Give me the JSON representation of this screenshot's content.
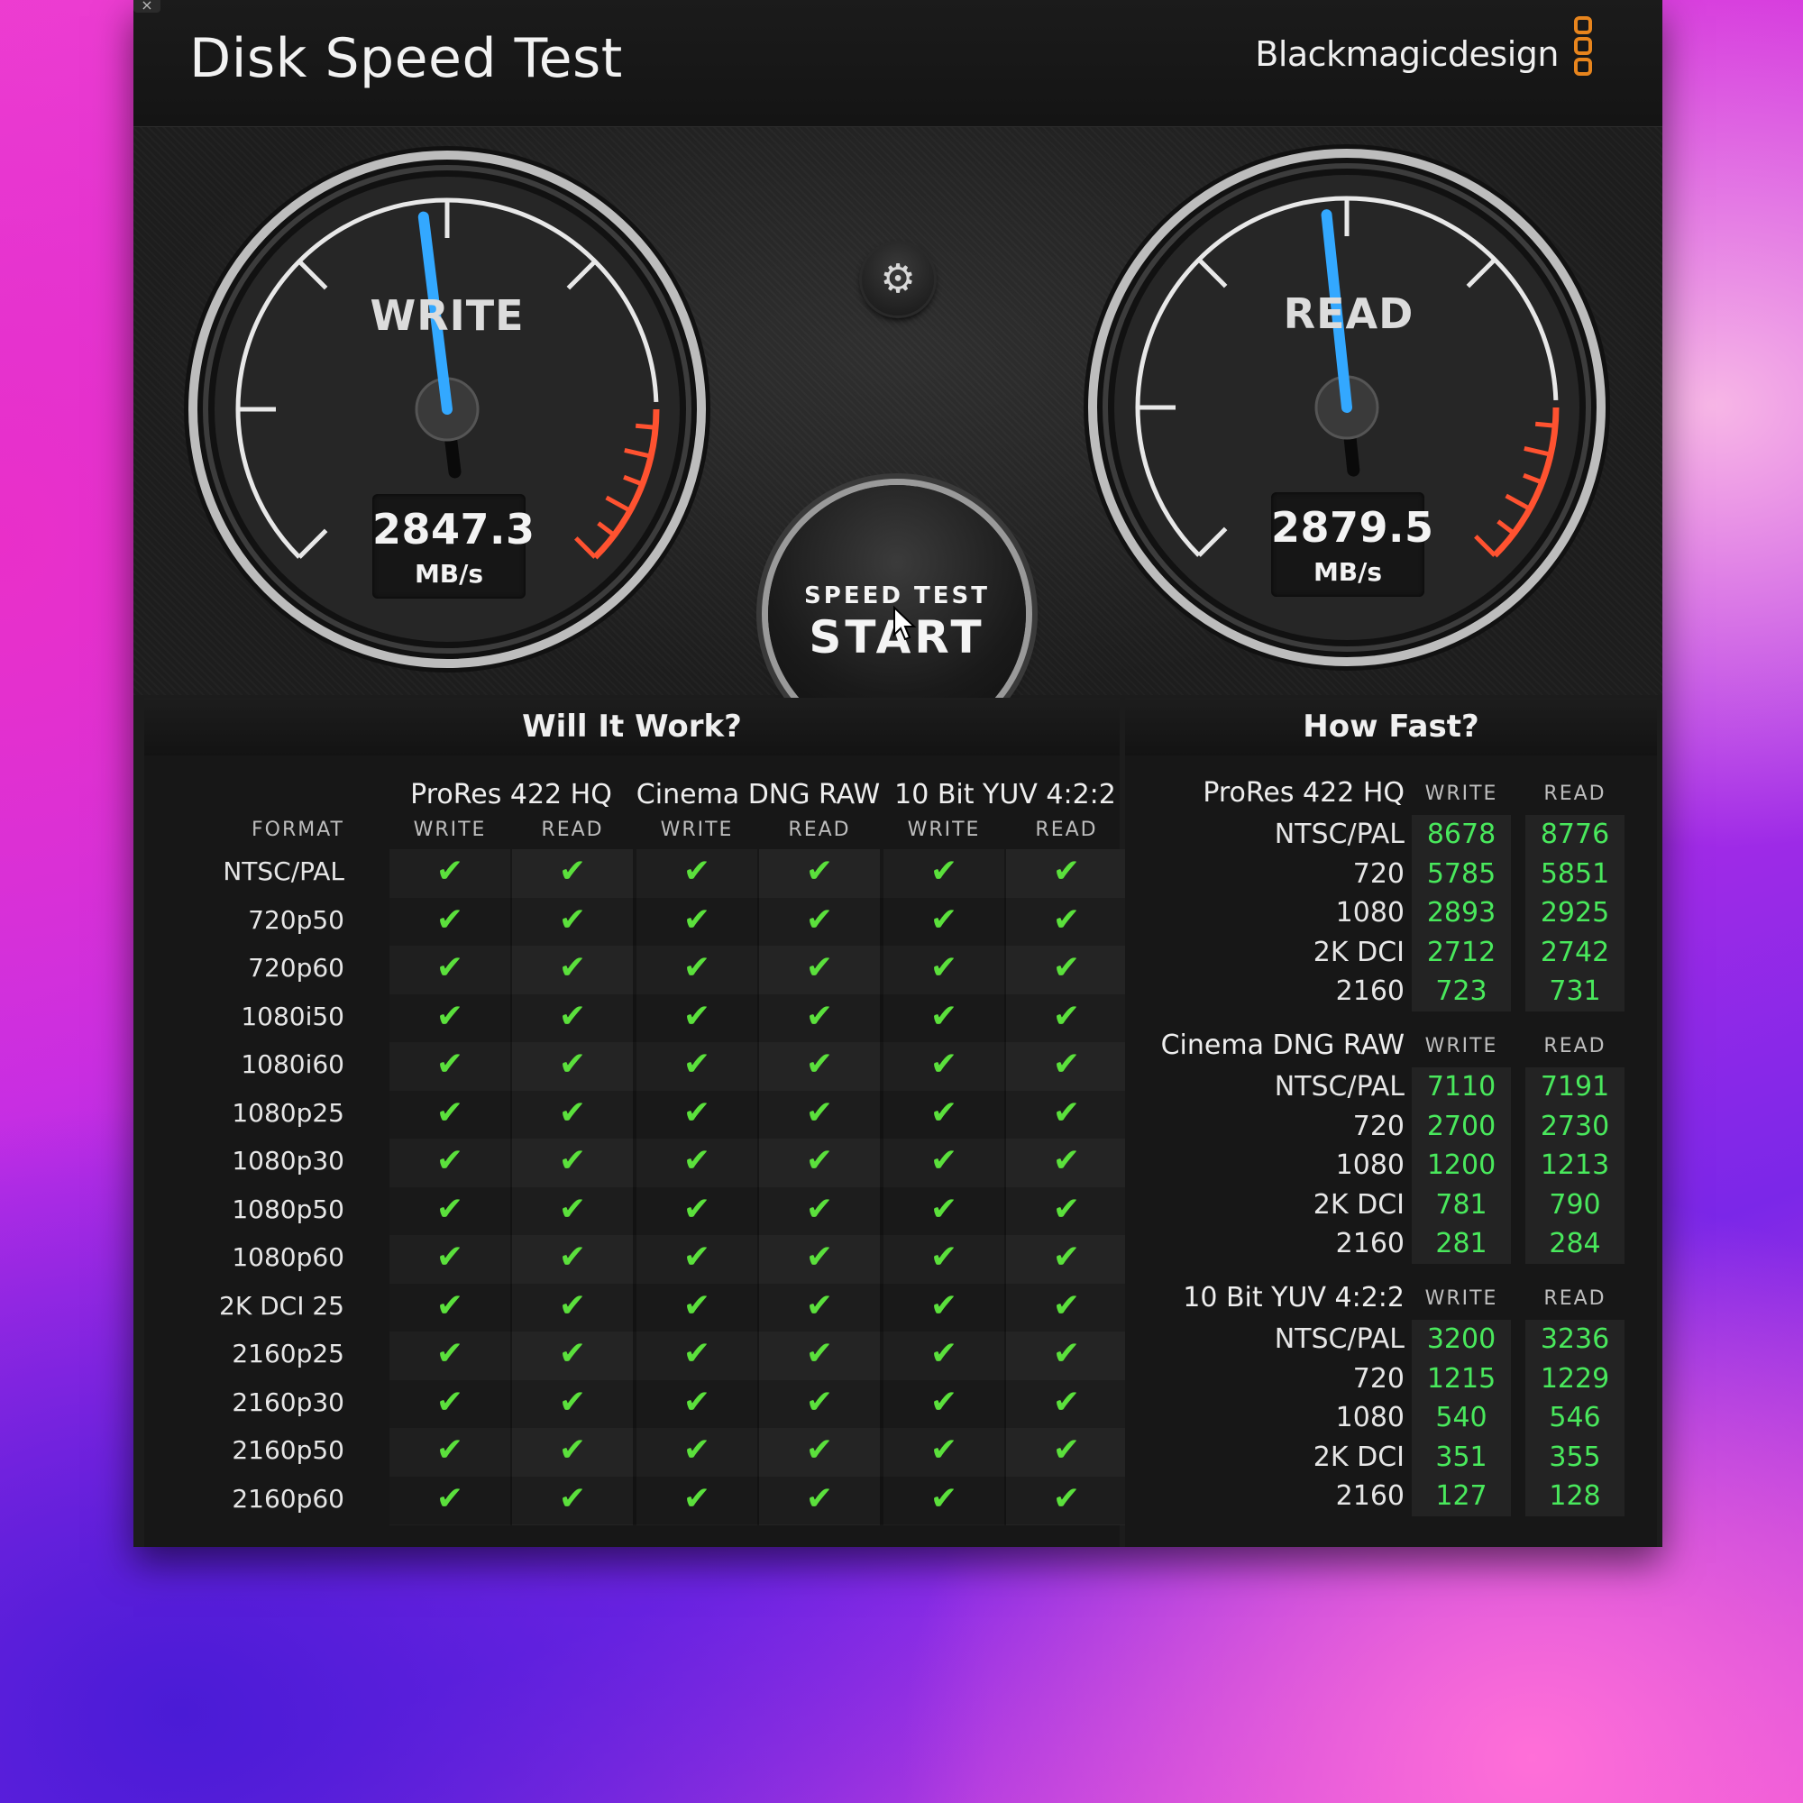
{
  "window": {
    "title": "Disk Speed Test",
    "brand": "Blackmagicdesign",
    "close_glyph": "×"
  },
  "gauges": {
    "write": {
      "label": "WRITE",
      "value": "2847.3",
      "unit": "MB/s"
    },
    "read": {
      "label": "READ",
      "value": "2879.5",
      "unit": "MB/s"
    },
    "accent": "#33a8ff",
    "redline": "#ff5230"
  },
  "controls": {
    "settings_icon": "gear-icon",
    "start_small": "SPEED TEST",
    "start_big": "START"
  },
  "will_it_work": {
    "title": "Will It Work?",
    "format_header": "FORMAT",
    "codecs": [
      "ProRes 422 HQ",
      "Cinema DNG RAW",
      "10 Bit YUV 4:2:2"
    ],
    "sub_headers": [
      "WRITE",
      "READ",
      "WRITE",
      "READ",
      "WRITE",
      "READ"
    ],
    "check": "✔",
    "check_color": "#5be03c",
    "rows": [
      "NTSC/PAL",
      "720p50",
      "720p60",
      "1080i50",
      "1080i60",
      "1080p25",
      "1080p30",
      "1080p50",
      "1080p60",
      "2K DCI 25",
      "2160p25",
      "2160p30",
      "2160p50",
      "2160p60"
    ]
  },
  "how_fast": {
    "title": "How Fast?",
    "write_header": "WRITE",
    "read_header": "READ",
    "value_color": "#49e85c",
    "groups": [
      {
        "name": "ProRes 422 HQ",
        "rows": [
          {
            "label": "NTSC/PAL",
            "write": "8678",
            "read": "8776"
          },
          {
            "label": "720",
            "write": "5785",
            "read": "5851"
          },
          {
            "label": "1080",
            "write": "2893",
            "read": "2925"
          },
          {
            "label": "2K DCI",
            "write": "2712",
            "read": "2742"
          },
          {
            "label": "2160",
            "write": "723",
            "read": "731"
          }
        ]
      },
      {
        "name": "Cinema DNG RAW",
        "rows": [
          {
            "label": "NTSC/PAL",
            "write": "7110",
            "read": "7191"
          },
          {
            "label": "720",
            "write": "2700",
            "read": "2730"
          },
          {
            "label": "1080",
            "write": "1200",
            "read": "1213"
          },
          {
            "label": "2K DCI",
            "write": "781",
            "read": "790"
          },
          {
            "label": "2160",
            "write": "281",
            "read": "284"
          }
        ]
      },
      {
        "name": "10 Bit YUV 4:2:2",
        "rows": [
          {
            "label": "NTSC/PAL",
            "write": "3200",
            "read": "3236"
          },
          {
            "label": "720",
            "write": "1215",
            "read": "1229"
          },
          {
            "label": "1080",
            "write": "540",
            "read": "546"
          },
          {
            "label": "2K DCI",
            "write": "351",
            "read": "355"
          },
          {
            "label": "2160",
            "write": "127",
            "read": "128"
          }
        ]
      }
    ]
  }
}
